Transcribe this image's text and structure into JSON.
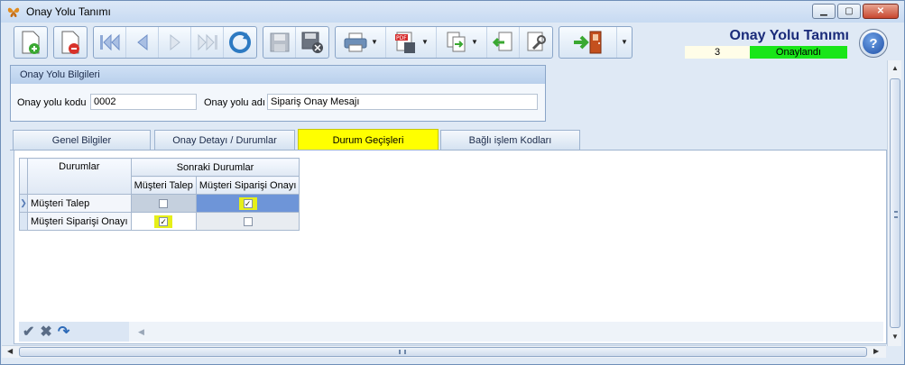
{
  "window": {
    "title": "Onay Yolu Tanımı"
  },
  "header": {
    "title": "Onay Yolu Tanımı",
    "number": "3",
    "status": "Onaylandı"
  },
  "colors": {
    "status_bg": "#19e619",
    "active_tab": "#ffff00",
    "highlight": "#e6ef18",
    "title_text": "#1a2b7a"
  },
  "toolbar": {
    "buttons": [
      "new-document-icon",
      "delete-document-icon",
      "first-record-icon",
      "previous-record-icon",
      "next-record-icon",
      "last-record-icon",
      "refresh-icon",
      "save-icon",
      "save-close-icon",
      "print-icon",
      "pdf-export-icon",
      "copy-icon",
      "import-icon",
      "tools-icon",
      "exit-door-icon"
    ]
  },
  "group": {
    "title": "Onay Yolu Bilgileri",
    "code_label": "Onay yolu kodu",
    "code_value": "0002",
    "name_label": "Onay yolu adı",
    "name_value": "Sipariş Onay Mesajı"
  },
  "tabs": [
    "Genel Bilgiler",
    "Onay Detayı / Durumlar",
    "Durum Geçişleri",
    "Bağlı işlem Kodları"
  ],
  "grid": {
    "col_durumlar": "Durumlar",
    "col_sonraki": "Sonraki Durumlar",
    "sub_cols": [
      "Müşteri Talep",
      "Müşteri Siparişi Onayı"
    ],
    "rows": [
      {
        "label": "Müşteri Talep",
        "values": [
          false,
          true
        ]
      },
      {
        "label": "Müşteri Siparişi Onayı",
        "values": [
          true,
          false
        ]
      }
    ]
  },
  "navbar": {
    "icons": [
      "check-icon",
      "cancel-x-icon",
      "redo-icon"
    ]
  }
}
